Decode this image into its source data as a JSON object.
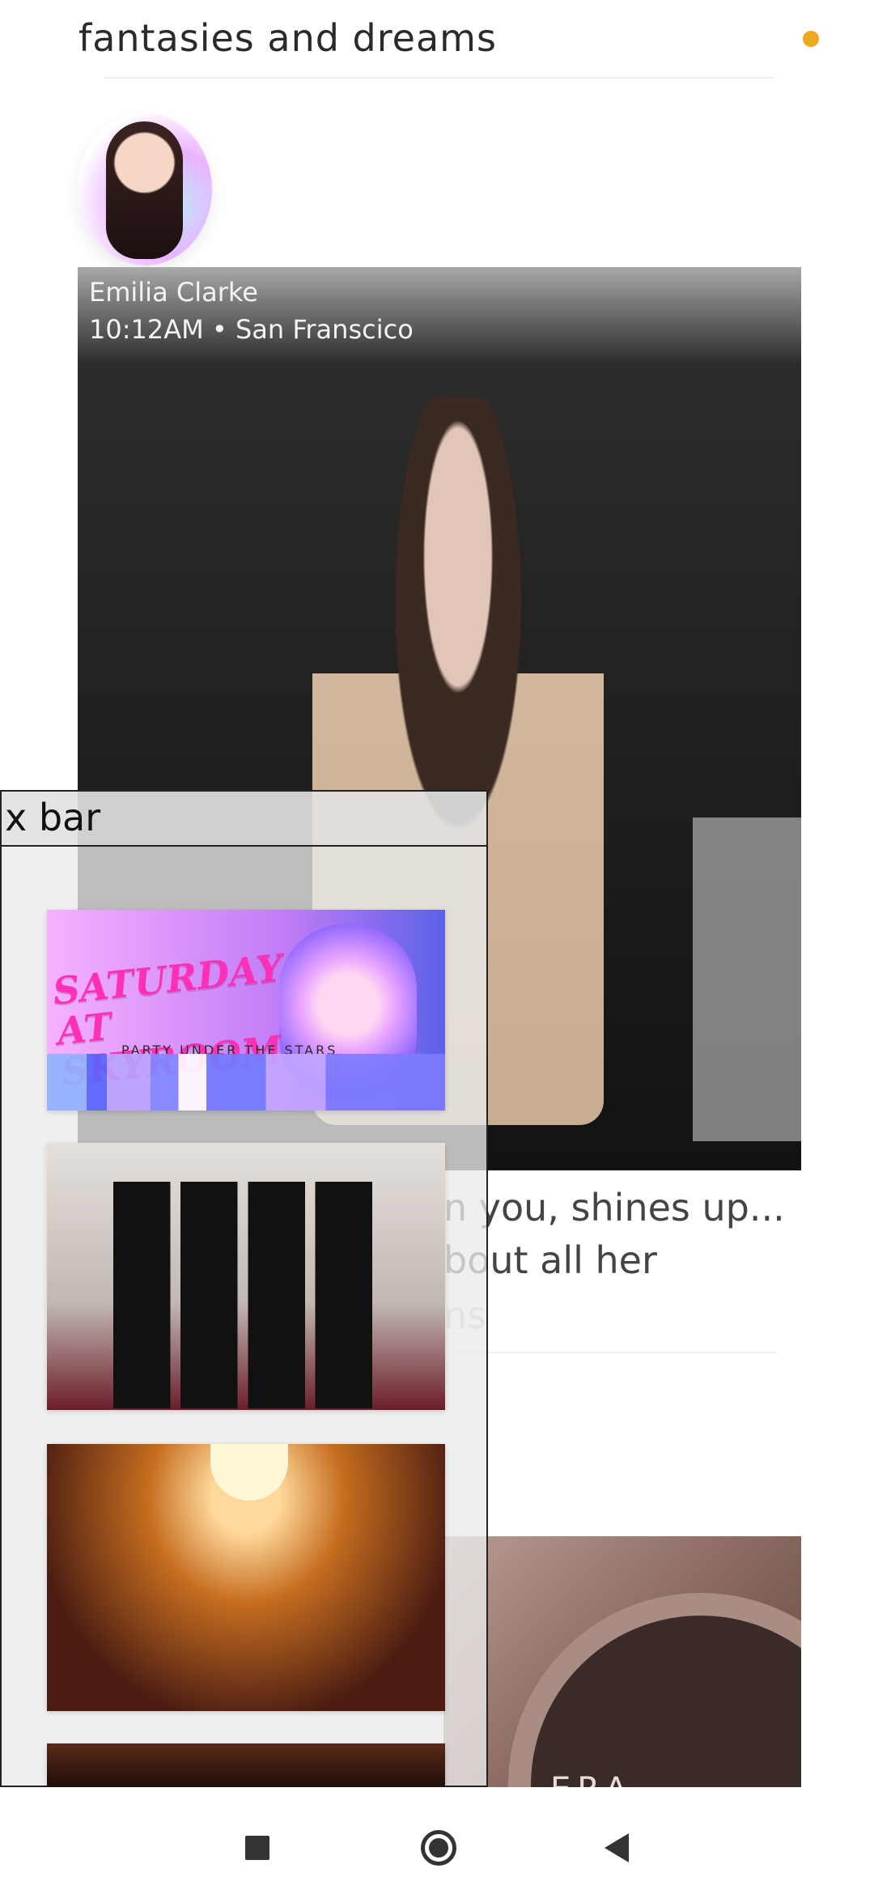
{
  "header": {
    "title": "fantasies and dreams",
    "accent_color": "#f0a81e"
  },
  "post": {
    "author_name": "Emilia Clarke",
    "author_meta": "10:12AM • San Franscico",
    "caption_lines": [
      "n you, shines up...",
      "bout all her",
      "ns"
    ]
  },
  "second_post": {
    "image_text": "ERA"
  },
  "box_panel": {
    "title": "x bar",
    "items": [
      {
        "icon": "event-image",
        "title_line1": "SATURDAY",
        "title_line2": "AT SKYROOM",
        "subtitle": "PARTY UNDER THE STARS"
      },
      {
        "icon": "musicians-image"
      },
      {
        "icon": "opera-hall-image"
      },
      {
        "icon": "performance-image"
      }
    ]
  },
  "nav": {
    "recents_icon": "square-icon",
    "home_icon": "circle-icon",
    "back_icon": "triangle-back-icon"
  }
}
